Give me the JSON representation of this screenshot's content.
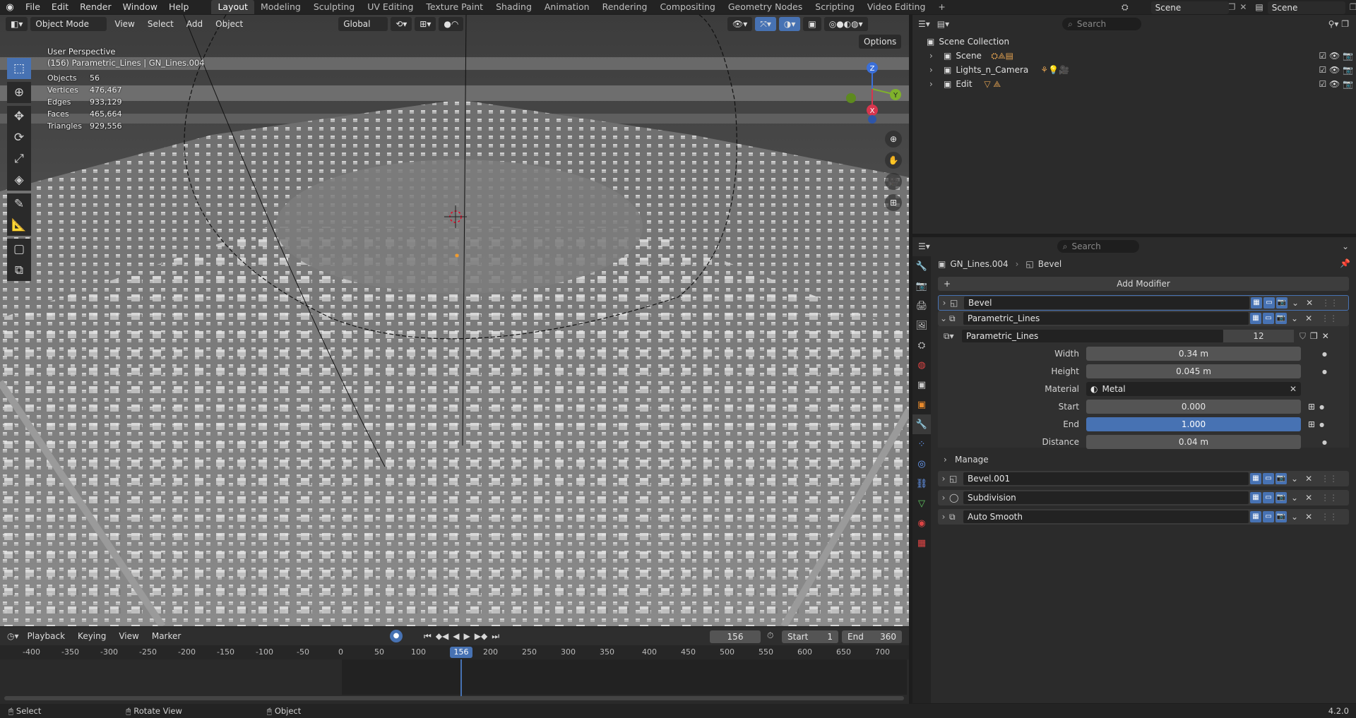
{
  "topbar": {
    "menus": [
      "File",
      "Edit",
      "Render",
      "Window",
      "Help"
    ],
    "workspaces": [
      "Layout",
      "Modeling",
      "Sculpting",
      "UV Editing",
      "Texture Paint",
      "Shading",
      "Animation",
      "Rendering",
      "Compositing",
      "Geometry Nodes",
      "Scripting",
      "Video Editing"
    ],
    "active_workspace": "Layout",
    "add_tab": "+",
    "scene_name": "Scene",
    "view_layer": "Scene"
  },
  "viewport": {
    "mode": "Object Mode",
    "menus": [
      "View",
      "Select",
      "Add",
      "Object"
    ],
    "orientation": "Global",
    "options": "Options",
    "perspective": "User Perspective",
    "active_object": "(156) Parametric_Lines | GN_Lines.004",
    "stats": [
      {
        "k": "Objects",
        "v": "56"
      },
      {
        "k": "Vertices",
        "v": "476,467"
      },
      {
        "k": "Edges",
        "v": "933,129"
      },
      {
        "k": "Faces",
        "v": "465,664"
      },
      {
        "k": "Triangles",
        "v": "929,556"
      }
    ],
    "gizmo": {
      "x": "X",
      "y": "Y",
      "z": "Z"
    }
  },
  "timeline": {
    "menus": [
      "Playback",
      "Keying",
      "View",
      "Marker"
    ],
    "current_frame": "156",
    "start_label": "Start",
    "start": "1",
    "end_label": "End",
    "end": "360",
    "ruler": [
      "-400",
      "-350",
      "-300",
      "-250",
      "-200",
      "-150",
      "-100",
      "-50",
      "0",
      "50",
      "100",
      "150",
      "200",
      "250",
      "300",
      "350",
      "400",
      "450",
      "500",
      "550",
      "600",
      "650",
      "700"
    ],
    "playhead": "156"
  },
  "status": {
    "select": "Select",
    "rotate": "Rotate View",
    "object": "Object",
    "version": "4.2.0"
  },
  "outliner": {
    "search_placeholder": "Search",
    "root": "Scene Collection",
    "items": [
      {
        "label": "Scene"
      },
      {
        "label": "Lights_n_Camera"
      },
      {
        "label": "Edit"
      }
    ]
  },
  "properties": {
    "search_placeholder": "Search",
    "breadcrumb_object": "GN_Lines.004",
    "breadcrumb_modifier": "Bevel",
    "add_modifier": "Add Modifier",
    "modifiers": [
      {
        "name": "Bevel"
      },
      {
        "name": "Parametric_Lines"
      },
      {
        "name": "Bevel.001"
      },
      {
        "name": "Subdivision"
      },
      {
        "name": "Auto Smooth"
      }
    ],
    "node_group": "Parametric_Lines",
    "node_users": "12",
    "params": [
      {
        "label": "Width",
        "value": "0.34 m"
      },
      {
        "label": "Height",
        "value": "0.045 m"
      },
      {
        "label": "Material",
        "value": "Metal"
      },
      {
        "label": "Start",
        "value": "0.000"
      },
      {
        "label": "End",
        "value": "1.000"
      },
      {
        "label": "Distance",
        "value": "0.04 m"
      }
    ],
    "manage": "Manage"
  }
}
